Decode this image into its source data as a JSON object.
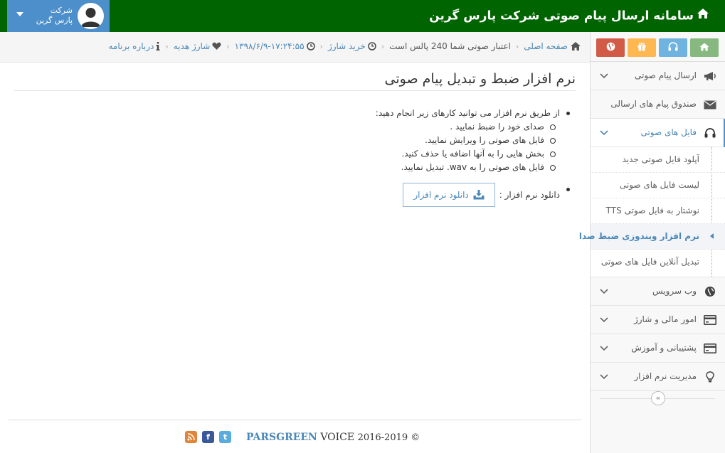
{
  "header": {
    "title": "سامانه ارسال پیام صوتی شرکت پارس گرین",
    "user_line1": "شرکت",
    "user_line2": "پارس گرین"
  },
  "breadcrumbs": {
    "home": "صفحه اصلی",
    "credit": "اعتبار صوتی شما 240 پالس است",
    "buy": "خرید شارژ",
    "datetime": "۱۳۹۸/۶/۹-۱۷:۲۴:۵۵",
    "gift": "شارژ هدیه",
    "about": "درباره برنامه"
  },
  "sidebar": {
    "items": [
      {
        "label": "ارسال پیام صوتی",
        "icon": "megaphone-icon"
      },
      {
        "label": "صندوق پیام های ارسالی",
        "icon": "envelope-icon"
      },
      {
        "label": "فایل های صوتی",
        "icon": "headphones-icon"
      },
      {
        "label": "وب سرویس",
        "icon": "globe-icon"
      },
      {
        "label": "امور مالی و شارژ",
        "icon": "credit-card-icon"
      },
      {
        "label": "پشتیبانی و آموزش",
        "icon": "credit-card-icon"
      },
      {
        "label": "مدیریت نرم افزار",
        "icon": "lightbulb-icon"
      }
    ],
    "submenu": [
      "آپلود فایل صوتی جدید",
      "لیست فایل های صوتی",
      "نوشتار به فایل صوتی TTS",
      "نرم افزار ویندوزی ضبط صدا",
      "تبدیل آنلاین فایل های صوتی"
    ],
    "collapse": "«"
  },
  "main": {
    "title": "نرم افزار ضبط و تبدیل پیام صوتی",
    "intro": "از طریق نرم افزار می توانید کارهای زیر انجام دهید:",
    "features": [
      "صدای خود را ضبط نمایید .",
      "فایل های صوتی را ویرایش نمایید.",
      "بخش هایی را به آنها اضافه یا حذف کنید.",
      "فایل های صوتی را به wav. تبدیل نمایید."
    ],
    "download_label": "دانلود نرم افزار :",
    "download_button": "دانلود نرم افزار"
  },
  "footer": {
    "copyright_prefix": "2016-2019 ©",
    "brand": "PARSGREEN",
    "brand_suffix": "VOICE",
    "facebook": "f",
    "twitter": "t",
    "rss": "r"
  },
  "colors": {
    "topbar": "#006400",
    "user_box": "#4c8fcb",
    "accent": "#4b88b7"
  }
}
